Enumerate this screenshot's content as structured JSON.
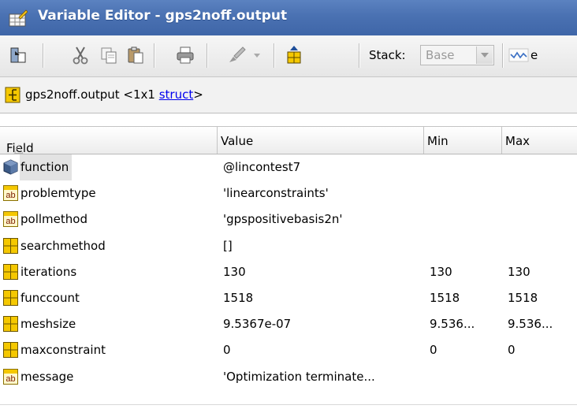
{
  "window": {
    "title": "Variable Editor - gps2noff.output"
  },
  "toolbar": {
    "stack_label": "Stack:",
    "stack_value": "Base",
    "plot_label": "e",
    "icons": [
      "import-data-icon",
      "cut-icon",
      "copy-icon",
      "paste-icon",
      "print-icon",
      "edit-brush-icon",
      "dropdown-arrow-icon",
      "new-variable-icon",
      "plot-icon"
    ]
  },
  "path": {
    "prefix": "gps2noff.output <1x1 ",
    "link": "struct",
    "suffix": ">"
  },
  "columns": {
    "field": "Field",
    "value": "Value",
    "min": "Min",
    "max": "Max"
  },
  "rows": [
    {
      "type": "function-handle",
      "field": "function",
      "value": "@lincontest7",
      "min": "",
      "max": ""
    },
    {
      "type": "char",
      "field": "problemtype",
      "value": "'linearconstraints'",
      "min": "",
      "max": ""
    },
    {
      "type": "char",
      "field": "pollmethod",
      "value": "'gpspositivebasis2n'",
      "min": "",
      "max": ""
    },
    {
      "type": "numeric",
      "field": "searchmethod",
      "value": "[]",
      "min": "",
      "max": ""
    },
    {
      "type": "numeric",
      "field": "iterations",
      "value": "130",
      "min": "130",
      "max": "130"
    },
    {
      "type": "numeric",
      "field": "funccount",
      "value": "1518",
      "min": "1518",
      "max": "1518"
    },
    {
      "type": "numeric",
      "field": "meshsize",
      "value": "9.5367e-07",
      "min": "9.536...",
      "max": "9.536..."
    },
    {
      "type": "numeric",
      "field": "maxconstraint",
      "value": "0",
      "min": "0",
      "max": "0"
    },
    {
      "type": "char",
      "field": "message",
      "value": "'Optimization terminate...",
      "min": "",
      "max": ""
    }
  ],
  "colors": {
    "titlebar": "#4a71b2",
    "link": "#0000ee",
    "numeric_icon": "#f5c800"
  }
}
